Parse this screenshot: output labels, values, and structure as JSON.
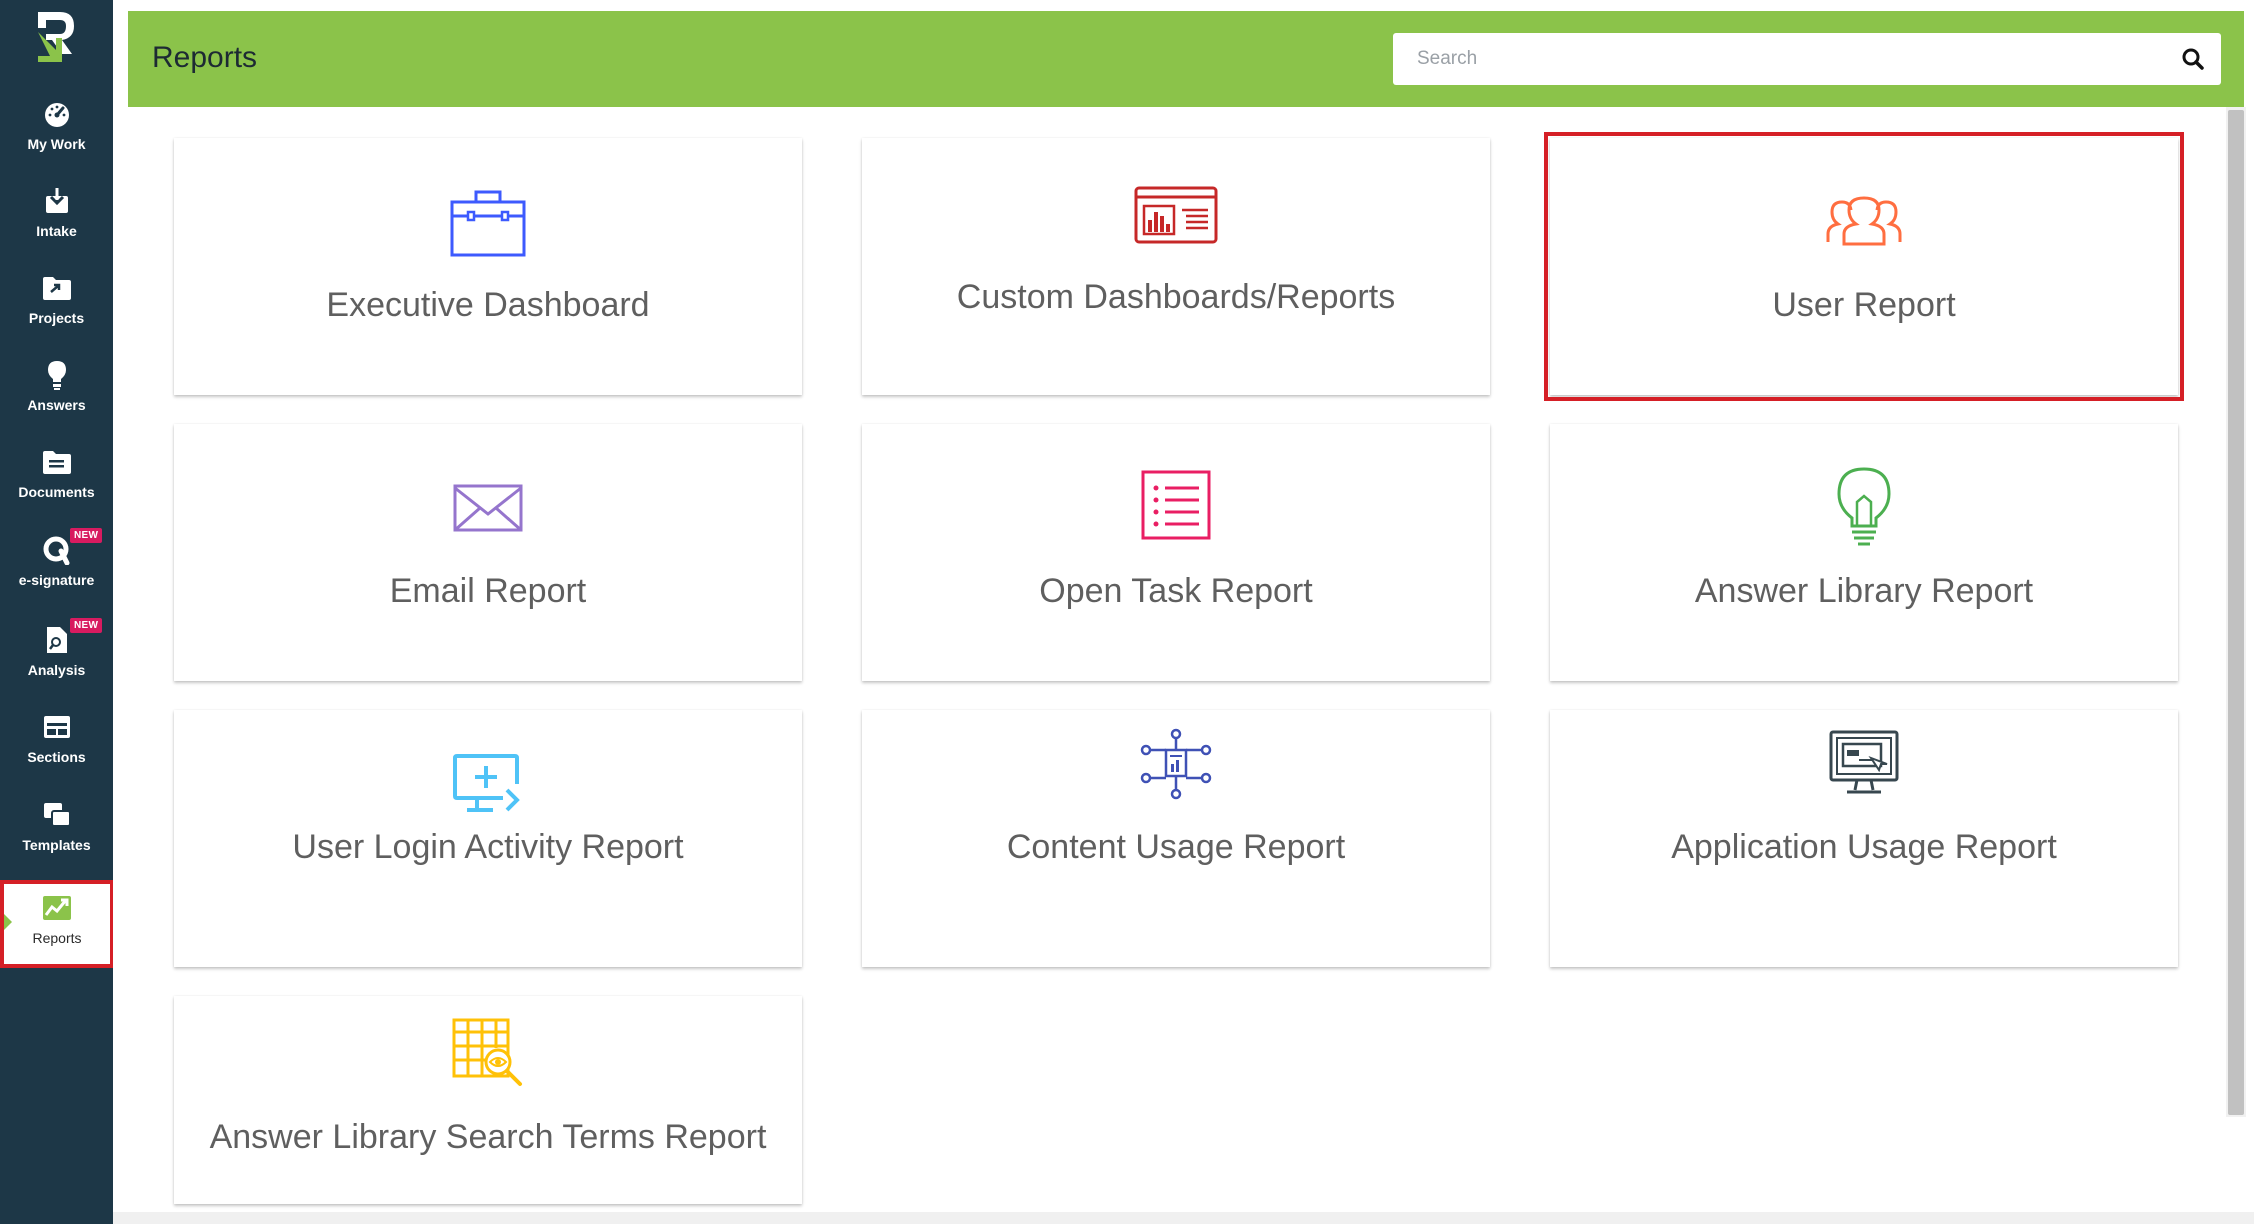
{
  "sidebar": {
    "items": [
      {
        "label": "My Work"
      },
      {
        "label": "Intake"
      },
      {
        "label": "Projects"
      },
      {
        "label": "Answers"
      },
      {
        "label": "Documents"
      },
      {
        "label": "e-signature",
        "badge": "NEW"
      },
      {
        "label": "Analysis",
        "badge": "NEW"
      },
      {
        "label": "Sections"
      },
      {
        "label": "Templates"
      },
      {
        "label": "Reports",
        "active": true
      }
    ]
  },
  "header": {
    "title": "Reports",
    "search_placeholder": "Search"
  },
  "cards": [
    {
      "title": "Executive Dashboard",
      "icon": "briefcase-icon",
      "color": "#3d5afe"
    },
    {
      "title": "Custom Dashboards/Reports",
      "icon": "dashboard-chart-icon",
      "color": "#c62828"
    },
    {
      "title": "User Report",
      "icon": "users-icon",
      "color": "#ff6e40",
      "highlighted": true
    },
    {
      "title": "Email Report",
      "icon": "envelope-icon",
      "color": "#9575cd"
    },
    {
      "title": "Open Task Report",
      "icon": "task-list-icon",
      "color": "#e91e63"
    },
    {
      "title": "Answer Library Report",
      "icon": "lightbulb-icon",
      "color": "#4caf50"
    },
    {
      "title": "User Login Activity Report",
      "icon": "monitor-login-icon",
      "color": "#4fc3f7"
    },
    {
      "title": "Content Usage Report",
      "icon": "content-network-icon",
      "color": "#3f51b5"
    },
    {
      "title": "Application Usage Report",
      "icon": "monitor-app-icon",
      "color": "#37474f"
    },
    {
      "title": "Answer Library Search Terms Report",
      "icon": "grid-search-icon",
      "color": "#ffc107"
    }
  ],
  "colors": {
    "sidebar_bg": "#1d3747",
    "header_bg": "#8bc34a",
    "highlight": "#d51f26",
    "badge": "#d81b60"
  }
}
